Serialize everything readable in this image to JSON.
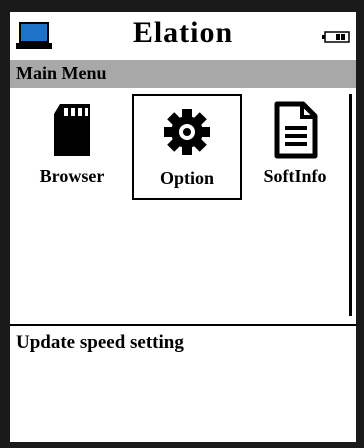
{
  "header": {
    "title": "Elation",
    "left_icon": "laptop-icon",
    "right_icon": "battery-icon"
  },
  "menu": {
    "heading": "Main Menu",
    "items": [
      {
        "label": "Browser",
        "icon": "sd-card-icon",
        "selected": false
      },
      {
        "label": "Option",
        "icon": "gear-icon",
        "selected": true
      },
      {
        "label": "SoftInfo",
        "icon": "document-icon",
        "selected": false
      }
    ]
  },
  "info": {
    "text": "Update speed setting"
  },
  "colors": {
    "bezel": "#1a1a1a",
    "screen": "#ffffff",
    "header_bar": "#a8a8a8",
    "laptop_screen": "#1e73c8"
  }
}
